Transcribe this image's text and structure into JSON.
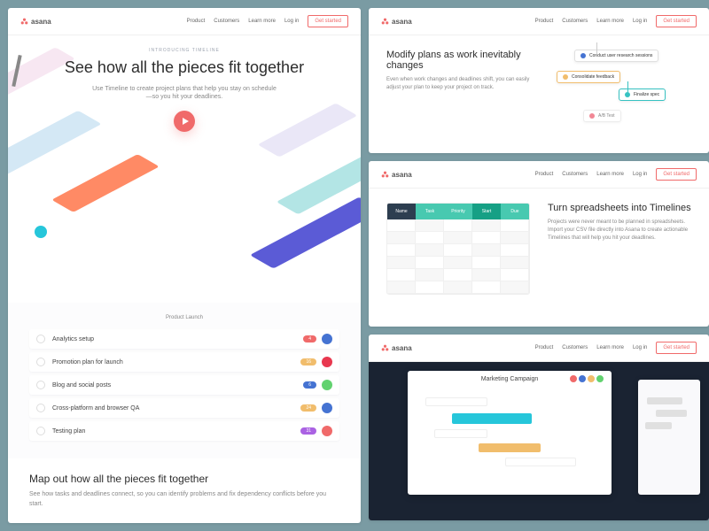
{
  "brand": "asana",
  "nav": {
    "links": [
      "Product",
      "Customers",
      "Learn more",
      "Log in"
    ],
    "cta": "Get started"
  },
  "hero": {
    "eyebrow": "INTRODUCING TIMELINE",
    "title": "See how all the pieces fit together",
    "subtitle": "Use Timeline to create project plans that help you stay on schedule—so you hit your deadlines."
  },
  "tasklist": {
    "header": "Product Launch",
    "tasks": [
      {
        "name": "Analytics setup",
        "badge": "4",
        "badge_color": "#f06a6a",
        "avatar": "#4573d2"
      },
      {
        "name": "Promotion plan for launch",
        "badge": "16",
        "badge_color": "#f1bd6c",
        "avatar": "#e8384f"
      },
      {
        "name": "Blog and social posts",
        "badge": "6",
        "badge_color": "#4573d2",
        "avatar": "#62d26f"
      },
      {
        "name": "Cross-platform and browser QA",
        "badge": "24",
        "badge_color": "#f1bd6c",
        "avatar": "#4573d2"
      },
      {
        "name": "Testing plan",
        "badge": "31",
        "badge_color": "#aa62e3",
        "avatar": "#f06a6a"
      }
    ]
  },
  "map_section": {
    "title": "Map out how all the pieces fit together",
    "body": "See how tasks and deadlines connect, so you can identify problems and fix dependency conflicts before you start."
  },
  "modify": {
    "title": "Modify plans as work inevitably changes",
    "body": "Even when work changes and deadlines shift, you can easily adjust your plan to keep your project on track.",
    "nodes": [
      {
        "label": "Conduct user research sessions",
        "color": "#4573d2"
      },
      {
        "label": "Consolidate feedback",
        "color": "#f1bd6c"
      },
      {
        "label": "Finalize spec",
        "color": "#37c2c2"
      },
      {
        "label": "A/B Test",
        "color": "#e8384f"
      }
    ]
  },
  "spreadsheet": {
    "title": "Turn spreadsheets into Timelines",
    "body": "Projects were never meant to be planned in spreadsheets. Import your CSV file directly into Asana to create actionable Timelines that will help you hit your deadlines.",
    "headers": [
      "Name",
      "Task",
      "Priority",
      "Start",
      "Due"
    ],
    "header_colors": [
      "#2d3e50",
      "#48c9b0",
      "#48c9b0",
      "#16a085",
      "#48c9b0"
    ]
  },
  "campaign": {
    "title": "Marketing Campaign"
  }
}
